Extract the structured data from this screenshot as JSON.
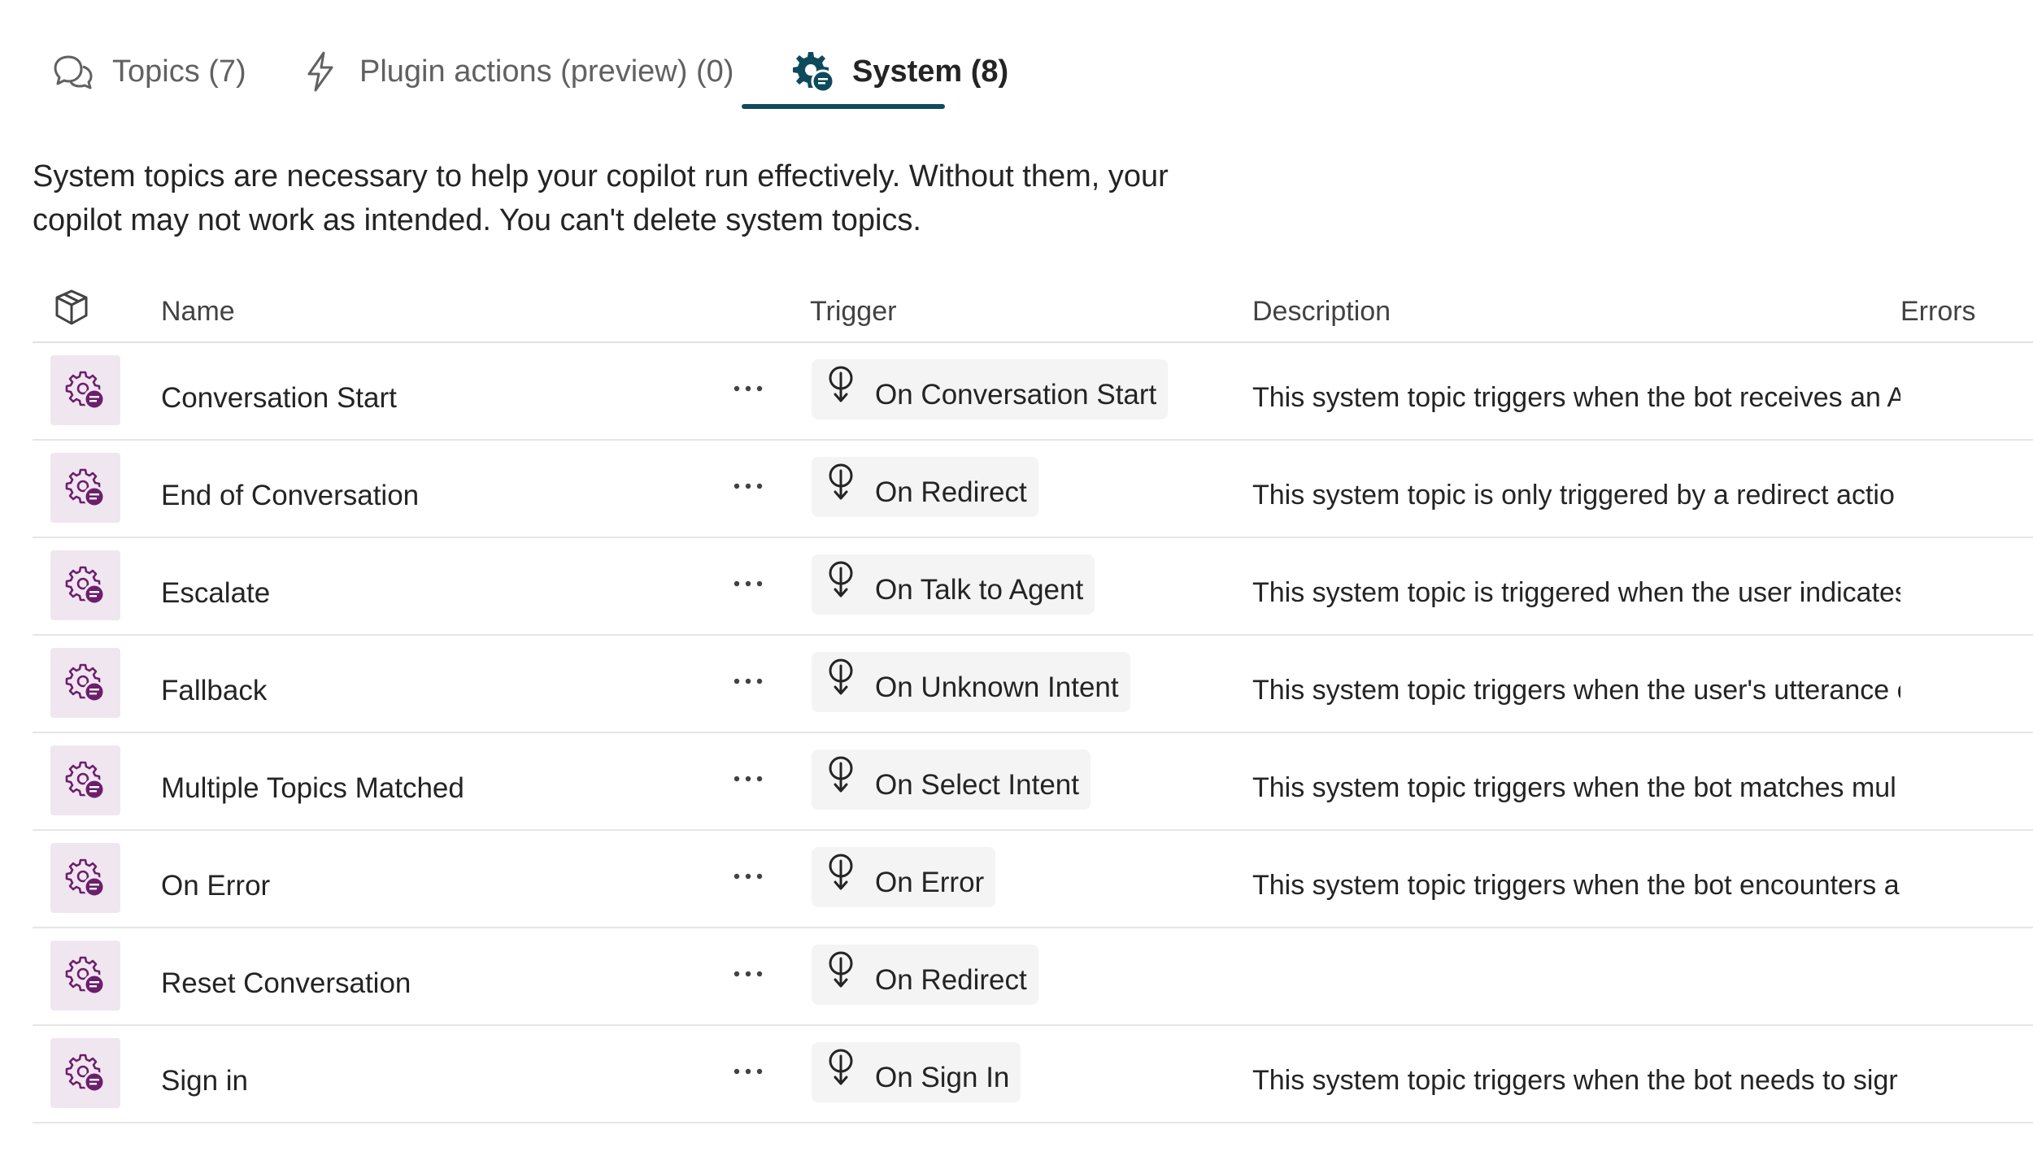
{
  "tabs": [
    {
      "label": "Topics (7)",
      "icon": "chat-bubbles-icon",
      "active": false
    },
    {
      "label": "Plugin actions (preview) (0)",
      "icon": "lightning-icon",
      "active": false
    },
    {
      "label": "System (8)",
      "icon": "gear-chat-icon",
      "active": true
    }
  ],
  "intro": {
    "line1": "System topics are necessary to help your copilot run effectively. Without them, your",
    "line2": "copilot may not work as intended. You can't delete system topics."
  },
  "table": {
    "headers": {
      "icon": "cube-icon",
      "name": "Name",
      "trigger": "Trigger",
      "description": "Description",
      "errors": "Errors"
    },
    "rows": [
      {
        "name": "Conversation Start",
        "trigger": "On Conversation Start",
        "description": "This system topic triggers when the bot receives an A"
      },
      {
        "name": "End of Conversation",
        "trigger": "On Redirect",
        "description": "This system topic is only triggered by a redirect actio"
      },
      {
        "name": "Escalate",
        "trigger": "On Talk to Agent",
        "description": "This system topic is triggered when the user indicates"
      },
      {
        "name": "Fallback",
        "trigger": "On Unknown Intent",
        "description": "This system topic triggers when the user's utterance c"
      },
      {
        "name": "Multiple Topics Matched",
        "trigger": "On Select Intent",
        "description": "This system topic triggers when the bot matches mul"
      },
      {
        "name": "On Error",
        "trigger": "On Error",
        "description": "This system topic triggers when the bot encounters a"
      },
      {
        "name": "Reset Conversation",
        "trigger": "On Redirect",
        "description": ""
      },
      {
        "name": "Sign in",
        "trigger": "On Sign In",
        "description": "This system topic triggers when the bot needs to sigr"
      }
    ]
  },
  "colors": {
    "accent": "#0e4a5c",
    "row_icon_bg": "#f0e6f0",
    "row_icon_fg": "#6b1f6b",
    "trigger_bg": "#f4f4f4"
  }
}
